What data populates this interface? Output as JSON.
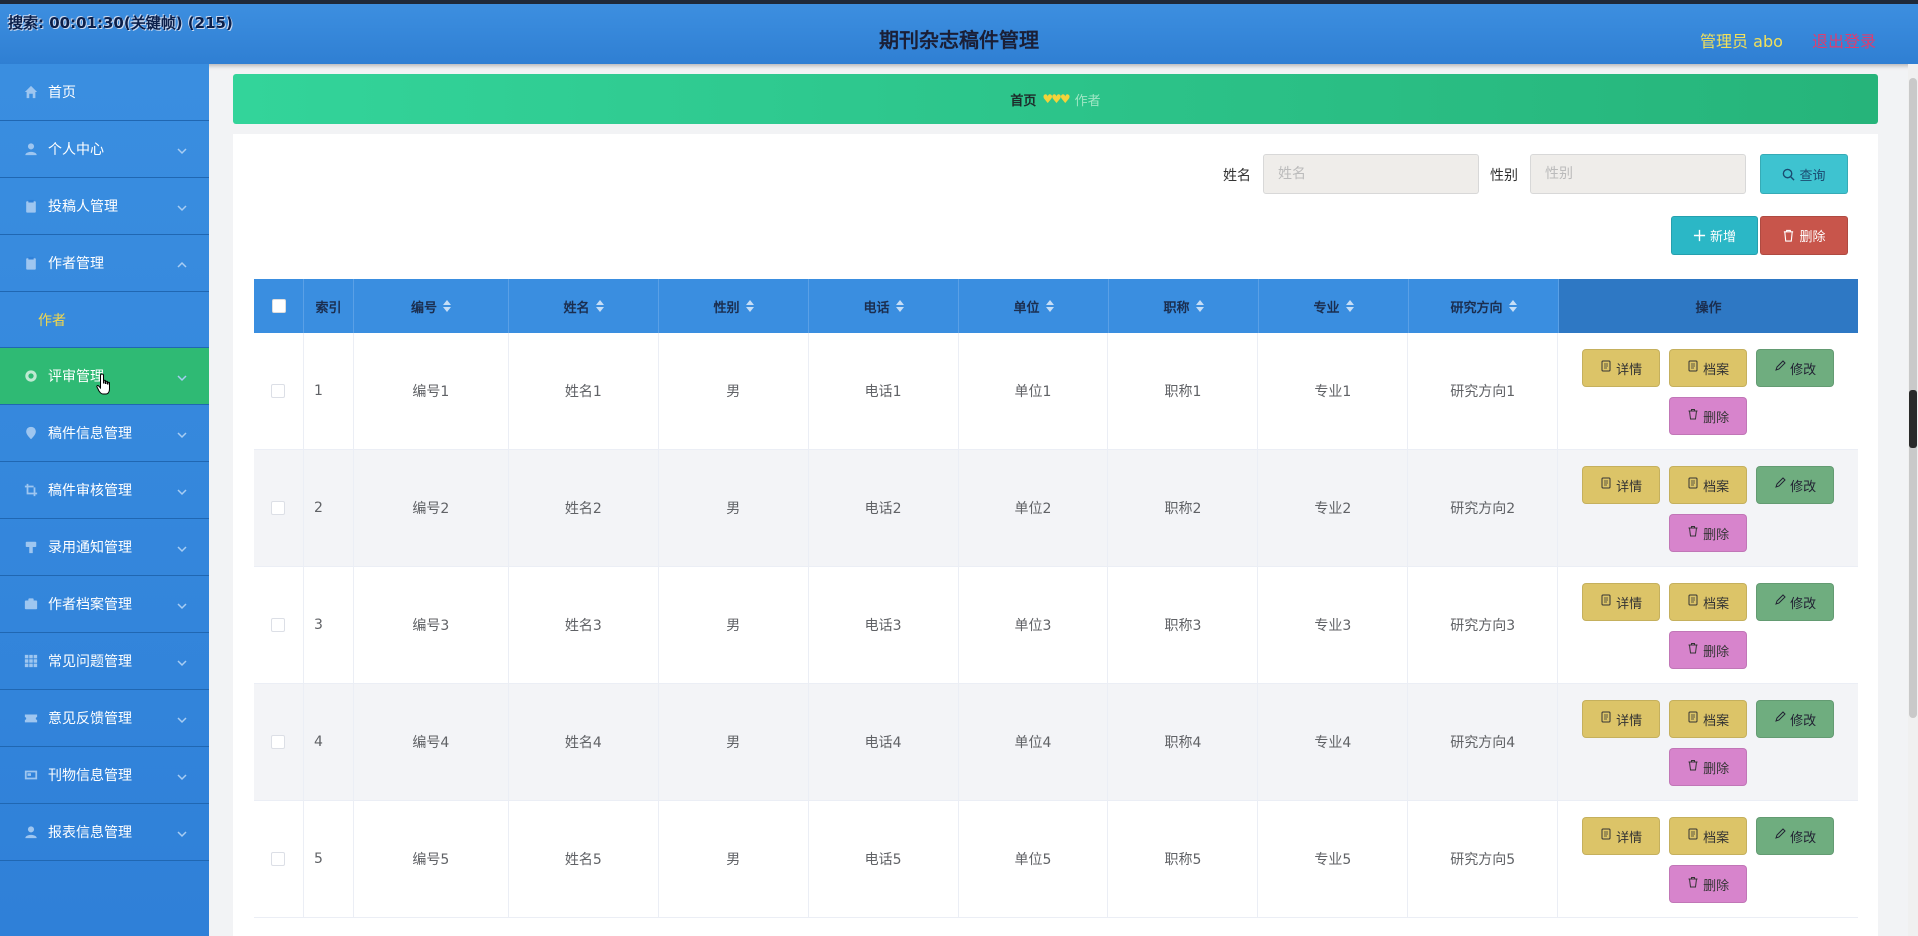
{
  "overlay": {
    "recording_label": "搜索: 00:01:30(关键帧) (215)"
  },
  "header": {
    "title": "期刊杂志稿件管理",
    "user": "管理员 abo",
    "logout": "退出登录"
  },
  "sidebar": {
    "items": [
      {
        "label": "首页",
        "icon": "home-icon",
        "has_arrow": false
      },
      {
        "label": "个人中心",
        "icon": "user-icon",
        "has_arrow": true
      },
      {
        "label": "投稿人管理",
        "icon": "clipboard-icon",
        "has_arrow": true
      },
      {
        "label": "作者管理",
        "icon": "clipboard-icon",
        "has_arrow": true,
        "expanded": true
      },
      {
        "label": "评审管理",
        "icon": "gear-icon",
        "has_arrow": true,
        "active": true
      },
      {
        "label": "稿件信息管理",
        "icon": "pin-icon",
        "has_arrow": true
      },
      {
        "label": "稿件审核管理",
        "icon": "crop-icon",
        "has_arrow": true
      },
      {
        "label": "录用通知管理",
        "icon": "podium-icon",
        "has_arrow": true
      },
      {
        "label": "作者档案管理",
        "icon": "briefcase-icon",
        "has_arrow": true
      },
      {
        "label": "常见问题管理",
        "icon": "grid-icon",
        "has_arrow": true
      },
      {
        "label": "意见反馈管理",
        "icon": "ticket-icon",
        "has_arrow": true
      },
      {
        "label": "刊物信息管理",
        "icon": "card-icon",
        "has_arrow": true
      },
      {
        "label": "报表信息管理",
        "icon": "user-icon",
        "has_arrow": true
      }
    ],
    "sub_items": {
      "作者管理": [
        "作者"
      ]
    }
  },
  "breadcrumb": {
    "home": "首页",
    "separator": "♥♥♥",
    "current": "作者"
  },
  "search": {
    "name_label": "姓名",
    "name_placeholder": "姓名",
    "gender_label": "性别",
    "gender_placeholder": "性别",
    "query_button": "查询"
  },
  "toolbar": {
    "add_button": "新增",
    "delete_button": "删除"
  },
  "table": {
    "columns": [
      "索引",
      "编号",
      "姓名",
      "性别",
      "电话",
      "单位",
      "职称",
      "专业",
      "研究方向",
      "操作"
    ],
    "rows": [
      {
        "index": "1",
        "code": "编号1",
        "name": "姓名1",
        "gender": "男",
        "phone": "电话1",
        "unit": "单位1",
        "title": "职称1",
        "major": "专业1",
        "research": "研究方向1"
      },
      {
        "index": "2",
        "code": "编号2",
        "name": "姓名2",
        "gender": "男",
        "phone": "电话2",
        "unit": "单位2",
        "title": "职称2",
        "major": "专业2",
        "research": "研究方向2"
      },
      {
        "index": "3",
        "code": "编号3",
        "name": "姓名3",
        "gender": "男",
        "phone": "电话3",
        "unit": "单位3",
        "title": "职称3",
        "major": "专业3",
        "research": "研究方向3"
      },
      {
        "index": "4",
        "code": "编号4",
        "name": "姓名4",
        "gender": "男",
        "phone": "电话4",
        "unit": "单位4",
        "title": "职称4",
        "major": "专业4",
        "research": "研究方向4"
      },
      {
        "index": "5",
        "code": "编号5",
        "name": "姓名5",
        "gender": "男",
        "phone": "电话5",
        "unit": "单位5",
        "title": "职称5",
        "major": "专业5",
        "research": "研究方向5"
      }
    ],
    "row_actions": {
      "detail": "详情",
      "archive": "档案",
      "edit": "修改",
      "delete": "删除"
    }
  },
  "colors": {
    "header_blue": "#3a8ee0",
    "active_green": "#2fba74",
    "accent_yellow": "#f5d84a",
    "logout_pink": "#e03c6e"
  }
}
